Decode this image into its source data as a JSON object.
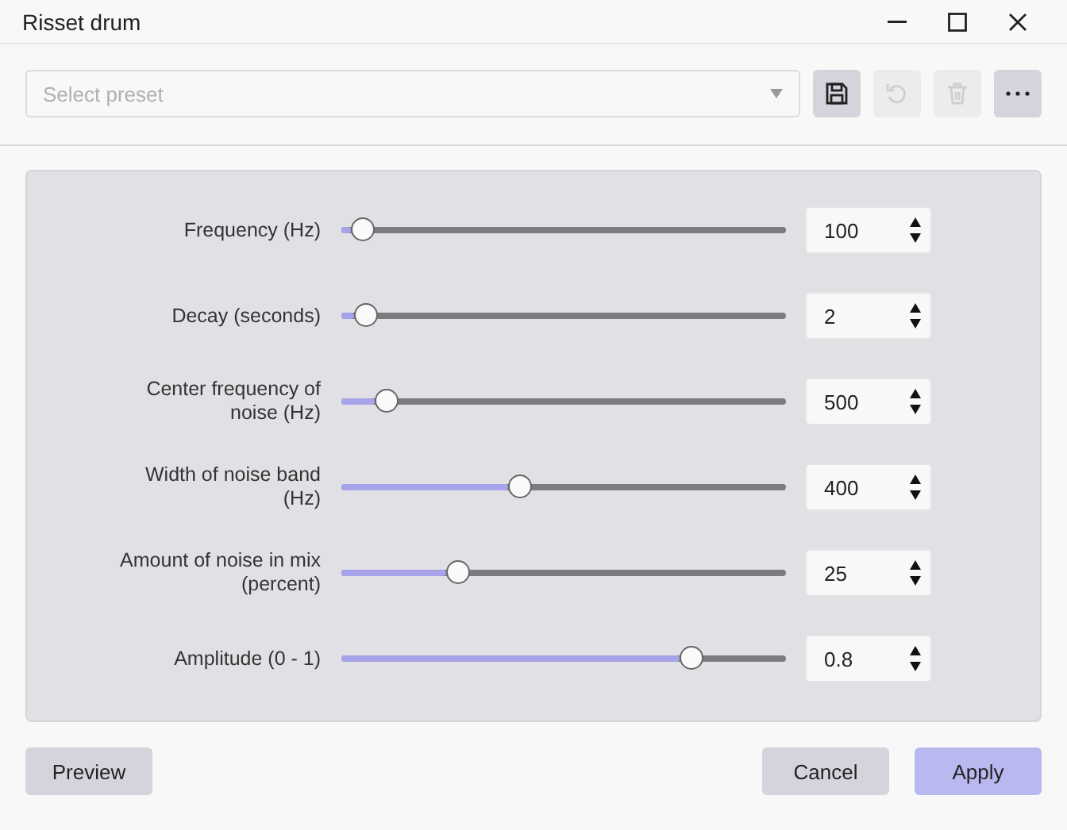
{
  "window": {
    "title": "Risset drum"
  },
  "preset": {
    "placeholder": "Select preset"
  },
  "toolbar": [
    {
      "kind": "save",
      "disabled": false
    },
    {
      "kind": "undo",
      "disabled": true
    },
    {
      "kind": "delete",
      "disabled": true
    },
    {
      "kind": "more",
      "disabled": false
    }
  ],
  "parameters": [
    {
      "label": "Frequency (Hz)",
      "level": 0.046,
      "value": "100"
    },
    {
      "label": "Decay (seconds)",
      "level": 0.054,
      "value": "2"
    },
    {
      "label": "Center frequency of noise (Hz)",
      "level": 0.1,
      "value": "500"
    },
    {
      "label": "Width of noise band (Hz)",
      "level": 0.4,
      "value": "400"
    },
    {
      "label": "Amount of noise in mix (percent)",
      "level": 0.26,
      "value": "25"
    },
    {
      "label": "Amplitude (0 - 1)",
      "level": 0.786,
      "value": "0.8"
    }
  ],
  "buttons": [
    {
      "label": "Preview",
      "kind": "secondary"
    },
    {
      "label": "Cancel",
      "kind": "secondary"
    },
    {
      "label": "Apply",
      "kind": "primary"
    }
  ]
}
